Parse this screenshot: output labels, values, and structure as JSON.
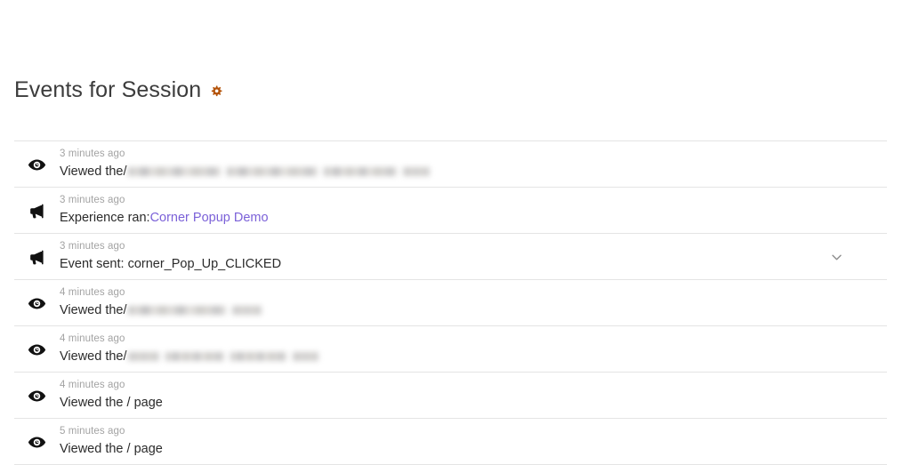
{
  "header": {
    "title": "Events for Session",
    "gear_icon": "gear-icon",
    "gear_color": "#b45309"
  },
  "colors": {
    "link": "#7b61d8",
    "text": "#2b2b2b",
    "muted": "#a3a3a3",
    "separator": "#e4e4e4",
    "gear": "#b45309"
  },
  "events": [
    {
      "icon": "eye-icon",
      "time": "3 minutes ago",
      "prefix": "Viewed the ",
      "redacted": true,
      "redacted_widths": [
        104,
        102,
        82,
        30
      ],
      "suffix": "",
      "link": null,
      "expandable": false
    },
    {
      "icon": "megaphone-icon",
      "time": "3 minutes ago",
      "prefix": "Experience ran: ",
      "redacted": false,
      "redacted_widths": [],
      "suffix": "",
      "link": "Corner Popup Demo",
      "expandable": false
    },
    {
      "icon": "megaphone-icon",
      "time": "3 minutes ago",
      "prefix": "Event sent: corner_Pop_Up_CLICKED",
      "redacted": false,
      "redacted_widths": [],
      "suffix": "",
      "link": null,
      "expandable": true
    },
    {
      "icon": "eye-icon",
      "time": "4 minutes ago",
      "prefix": "Viewed the ",
      "redacted": true,
      "redacted_widths": [
        110,
        33
      ],
      "suffix": "",
      "link": null,
      "expandable": false
    },
    {
      "icon": "eye-icon",
      "time": "4 minutes ago",
      "prefix": "Viewed the ",
      "redacted": true,
      "redacted_widths": [
        35,
        66,
        63,
        29
      ],
      "suffix": "",
      "link": null,
      "expandable": false
    },
    {
      "icon": "eye-icon",
      "time": "4 minutes ago",
      "prefix": "Viewed the / page",
      "redacted": false,
      "redacted_widths": [],
      "suffix": "",
      "link": null,
      "expandable": false
    },
    {
      "icon": "eye-icon",
      "time": "5 minutes ago",
      "prefix": "Viewed the / page",
      "redacted": false,
      "redacted_widths": [],
      "suffix": "",
      "link": null,
      "expandable": false
    }
  ]
}
